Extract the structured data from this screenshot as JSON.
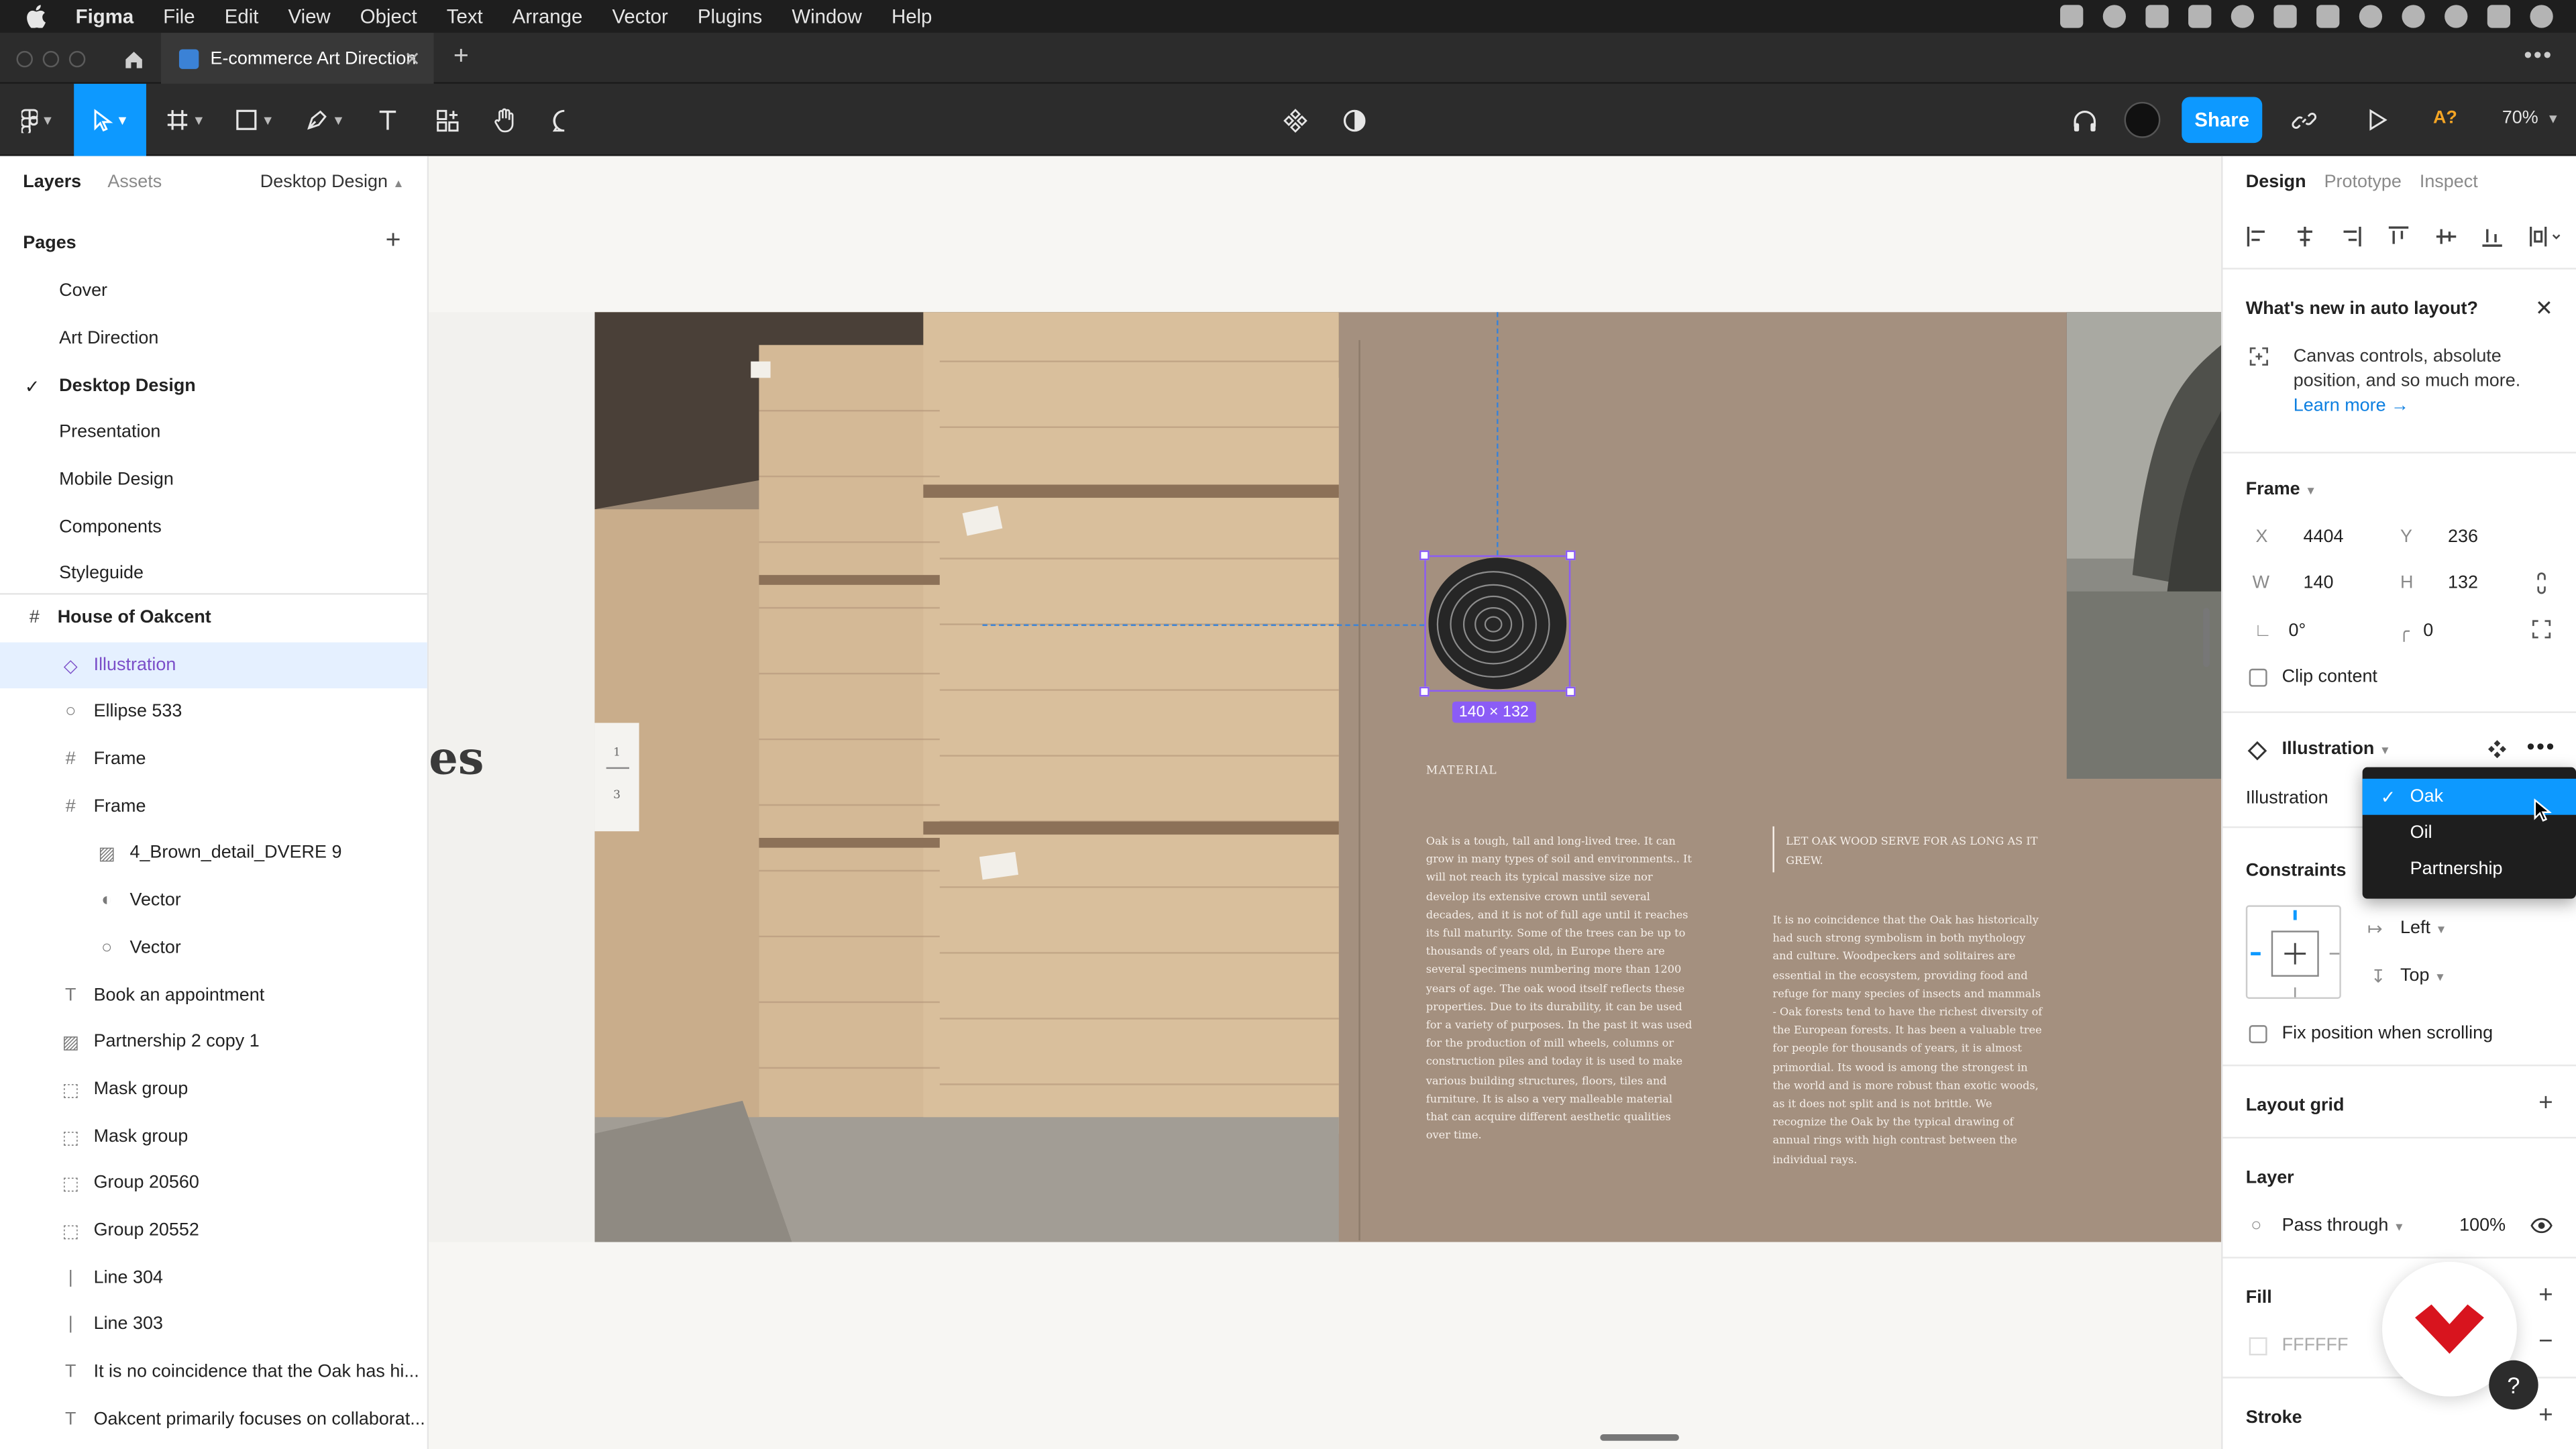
{
  "menubar": {
    "app": "Figma",
    "items": [
      "File",
      "Edit",
      "View",
      "Object",
      "Text",
      "Arrange",
      "Vector",
      "Plugins",
      "Window",
      "Help"
    ]
  },
  "tabbar": {
    "doc_title": "E-commerce Art Direction"
  },
  "toolbar": {
    "share_label": "Share",
    "zoom": "70%",
    "a_badge": "A?"
  },
  "left": {
    "tabs": {
      "layers": "Layers",
      "assets": "Assets"
    },
    "current_page": "Desktop Design",
    "pages_title": "Pages",
    "pages": [
      "Cover",
      "Art Direction",
      "Desktop Design",
      "Presentation",
      "Mobile Design",
      "Components",
      "Styleguide"
    ],
    "frame": "House of Oakcent",
    "layers": [
      {
        "name": "Illustration",
        "icon": "component-icon"
      },
      {
        "name": "Ellipse 533",
        "icon": "ellipse-icon"
      },
      {
        "name": "Frame",
        "icon": "frame-icon"
      },
      {
        "name": "Frame",
        "icon": "frame-icon"
      },
      {
        "name": "4_Brown_detail_DVERE 9",
        "icon": "image-icon"
      },
      {
        "name": "Vector",
        "icon": "vector-icon"
      },
      {
        "name": "Vector",
        "icon": "ellipse-icon"
      },
      {
        "name": "Book an appointment",
        "icon": "text-icon"
      },
      {
        "name": "Partnership 2 copy 1",
        "icon": "image-icon"
      },
      {
        "name": "Mask group",
        "icon": "group-icon"
      },
      {
        "name": "Mask group",
        "icon": "group-icon"
      },
      {
        "name": "Group 20560",
        "icon": "group-icon"
      },
      {
        "name": "Group 20552",
        "icon": "group-icon"
      },
      {
        "name": "Line 304",
        "icon": "line-icon"
      },
      {
        "name": "Line 303",
        "icon": "line-icon"
      },
      {
        "name": "It is no coincidence that the Oak has hi...",
        "icon": "text-icon"
      },
      {
        "name": "Oakcent primarily focuses on collaborat...",
        "icon": "text-icon"
      }
    ]
  },
  "canvas": {
    "heading_fragment": "es",
    "page_numbers": [
      "1",
      "3"
    ],
    "material_label": "MATERIAL",
    "body_left": "Oak is a tough, tall and long-lived tree. It can grow in many types of soil and environments.. It will not reach its typical massive size nor develop its extensive crown until several decades, and it is not of full age until it reaches its full maturity. Some of the trees can be up to thousands of years old, in Europe there are several specimens numbering more than 1200 years of age. The oak wood itself reflects these properties. Due to its durability, it can be used for a variety of purposes. In the past it was used for the production of mill wheels, columns or construction piles and today it is used to make various building structures, floors, tiles and furniture. It is also a very malleable material that can acquire different aesthetic qualities over time.",
    "quote": "LET OAK WOOD SERVE FOR AS LONG AS IT GREW.",
    "body_right": "It is no coincidence that the Oak has historically had such strong symbolism in both mythology and culture. Woodpeckers and solitaires are essential in the ecosystem, providing food and refuge for many species of insects and mammals - Oak forests tend to have the richest diversity of the European forests. It has been a valuable tree for people for thousands of years, it is almost primordial. Its wood is among the strongest in the world and is more robust than exotic woods, as it does not split and is not brittle. We recognize the Oak by the typical drawing of annual rings with high contrast between the individual rays.",
    "selection_dims": "140 × 132"
  },
  "right": {
    "tabs": {
      "design": "Design",
      "prototype": "Prototype",
      "inspect": "Inspect"
    },
    "whats_new": {
      "title": "What's new in auto layout?",
      "body": "Canvas controls, absolute position, and so much more.",
      "link": "Learn more →"
    },
    "frame": {
      "title": "Frame",
      "x_label": "X",
      "x": "4404",
      "y_label": "Y",
      "y": "236",
      "w_label": "W",
      "w": "140",
      "h_label": "H",
      "h": "132",
      "rotation": "0°",
      "radius": "0",
      "clip_label": "Clip content"
    },
    "component": {
      "title": "Illustration",
      "prop_label": "Illustration",
      "options": [
        "Oak",
        "Oil",
        "Partnership"
      ],
      "selected": "Oak"
    },
    "constraints": {
      "title": "Constraints",
      "horizontal": "Left",
      "vertical": "Top",
      "fix_label": "Fix position when scrolling"
    },
    "layout_grid": "Layout grid",
    "layer": {
      "title": "Layer",
      "blend": "Pass through",
      "opacity": "100%"
    },
    "fill": {
      "title": "Fill",
      "hex": "FFFFFF"
    },
    "stroke": "Stroke",
    "help": "?"
  },
  "colors": {
    "accent": "#0d99ff",
    "selection": "#8b5cf6",
    "artboard": "#a4907f"
  }
}
